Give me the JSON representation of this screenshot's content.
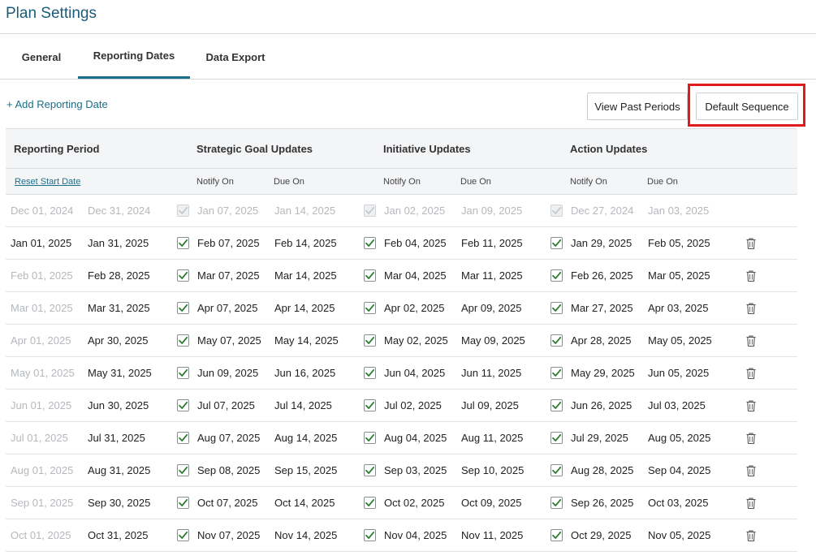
{
  "page": {
    "title": "Plan Settings"
  },
  "tabs": [
    {
      "label": "General",
      "active": false
    },
    {
      "label": "Reporting Dates",
      "active": true
    },
    {
      "label": "Data Export",
      "active": false
    }
  ],
  "toolbar": {
    "add_label": "+ Add Reporting Date",
    "view_past_label": "View Past Periods",
    "default_sequence_label": "Default Sequence"
  },
  "colors": {
    "accent": "#1a6f8a",
    "highlight": "#e11b1b",
    "check": "#2e7d32",
    "faded_text": "#b5b8bc"
  },
  "table": {
    "headers": {
      "reporting_period": "Reporting Period",
      "strategic": "Strategic Goal Updates",
      "initiative": "Initiative Updates",
      "action": "Action Updates"
    },
    "subheaders": {
      "reset": "Reset Start Date",
      "notify": "Notify On",
      "due": "Due On"
    },
    "rows": [
      {
        "past": true,
        "start": "Dec 01, 2024",
        "end": "Dec 31, 2024",
        "goal_notify": "Jan 07, 2025",
        "goal_due": "Jan 14, 2025",
        "init_notify": "Jan 02, 2025",
        "init_due": "Jan 09, 2025",
        "act_notify": "Dec 27, 2024",
        "act_due": "Jan 03, 2025"
      },
      {
        "past": false,
        "start_faded": false,
        "start": "Jan 01, 2025",
        "end": "Jan 31, 2025",
        "goal_notify": "Feb 07, 2025",
        "goal_due": "Feb 14, 2025",
        "init_notify": "Feb 04, 2025",
        "init_due": "Feb 11, 2025",
        "act_notify": "Jan 29, 2025",
        "act_due": "Feb 05, 2025"
      },
      {
        "past": false,
        "start_faded": true,
        "start": "Feb 01, 2025",
        "end": "Feb 28, 2025",
        "goal_notify": "Mar 07, 2025",
        "goal_due": "Mar 14, 2025",
        "init_notify": "Mar 04, 2025",
        "init_due": "Mar 11, 2025",
        "act_notify": "Feb 26, 2025",
        "act_due": "Mar 05, 2025"
      },
      {
        "past": false,
        "start_faded": true,
        "start": "Mar 01, 2025",
        "end": "Mar 31, 2025",
        "goal_notify": "Apr 07, 2025",
        "goal_due": "Apr 14, 2025",
        "init_notify": "Apr 02, 2025",
        "init_due": "Apr 09, 2025",
        "act_notify": "Mar 27, 2025",
        "act_due": "Apr 03, 2025"
      },
      {
        "past": false,
        "start_faded": true,
        "start": "Apr 01, 2025",
        "end": "Apr 30, 2025",
        "goal_notify": "May 07, 2025",
        "goal_due": "May 14, 2025",
        "init_notify": "May 02, 2025",
        "init_due": "May 09, 2025",
        "act_notify": "Apr 28, 2025",
        "act_due": "May 05, 2025"
      },
      {
        "past": false,
        "start_faded": true,
        "start": "May 01, 2025",
        "end": "May 31, 2025",
        "goal_notify": "Jun 09, 2025",
        "goal_due": "Jun 16, 2025",
        "init_notify": "Jun 04, 2025",
        "init_due": "Jun 11, 2025",
        "act_notify": "May 29, 2025",
        "act_due": "Jun 05, 2025"
      },
      {
        "past": false,
        "start_faded": true,
        "start": "Jun 01, 2025",
        "end": "Jun 30, 2025",
        "goal_notify": "Jul 07, 2025",
        "goal_due": "Jul 14, 2025",
        "init_notify": "Jul 02, 2025",
        "init_due": "Jul 09, 2025",
        "act_notify": "Jun 26, 2025",
        "act_due": "Jul 03, 2025"
      },
      {
        "past": false,
        "start_faded": true,
        "start": "Jul 01, 2025",
        "end": "Jul 31, 2025",
        "goal_notify": "Aug 07, 2025",
        "goal_due": "Aug 14, 2025",
        "init_notify": "Aug 04, 2025",
        "init_due": "Aug 11, 2025",
        "act_notify": "Jul 29, 2025",
        "act_due": "Aug 05, 2025"
      },
      {
        "past": false,
        "start_faded": true,
        "start": "Aug 01, 2025",
        "end": "Aug 31, 2025",
        "goal_notify": "Sep 08, 2025",
        "goal_due": "Sep 15, 2025",
        "init_notify": "Sep 03, 2025",
        "init_due": "Sep 10, 2025",
        "act_notify": "Aug 28, 2025",
        "act_due": "Sep 04, 2025"
      },
      {
        "past": false,
        "start_faded": true,
        "start": "Sep 01, 2025",
        "end": "Sep 30, 2025",
        "goal_notify": "Oct 07, 2025",
        "goal_due": "Oct 14, 2025",
        "init_notify": "Oct 02, 2025",
        "init_due": "Oct 09, 2025",
        "act_notify": "Sep 26, 2025",
        "act_due": "Oct 03, 2025"
      },
      {
        "past": false,
        "start_faded": true,
        "start": "Oct 01, 2025",
        "end": "Oct 31, 2025",
        "goal_notify": "Nov 07, 2025",
        "goal_due": "Nov 14, 2025",
        "init_notify": "Nov 04, 2025",
        "init_due": "Nov 11, 2025",
        "act_notify": "Oct 29, 2025",
        "act_due": "Nov 05, 2025"
      }
    ]
  }
}
